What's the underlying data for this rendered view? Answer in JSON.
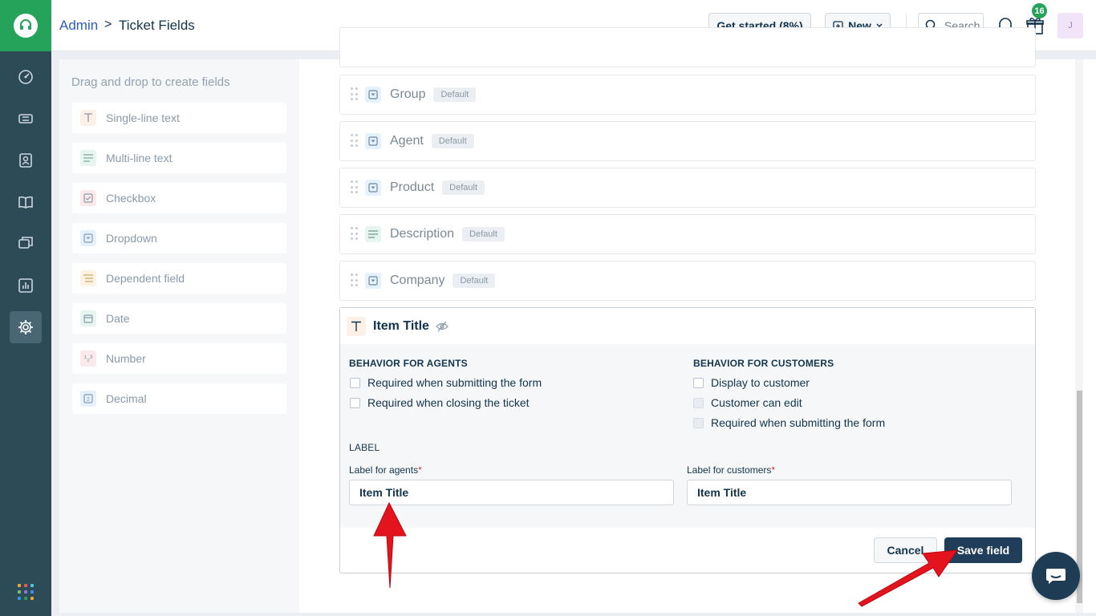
{
  "header": {
    "breadcrumb_root": "Admin",
    "breadcrumb_sep": ">",
    "page_title": "Ticket Fields",
    "get_started_label": "Get started (8%)",
    "new_label": "New",
    "search_placeholder": "Search",
    "notification_count": "16",
    "avatar_initial": "J"
  },
  "left_panel": {
    "title": "Drag and drop to create fields",
    "items": [
      {
        "label": "Single-line text",
        "icon": "single-line-text-icon"
      },
      {
        "label": "Multi-line text",
        "icon": "multi-line-text-icon"
      },
      {
        "label": "Checkbox",
        "icon": "checkbox-icon"
      },
      {
        "label": "Dropdown",
        "icon": "dropdown-icon"
      },
      {
        "label": "Dependent field",
        "icon": "dependent-field-icon"
      },
      {
        "label": "Date",
        "icon": "calendar-icon"
      },
      {
        "label": "Number",
        "icon": "number-icon"
      },
      {
        "label": "Decimal",
        "icon": "decimal-icon"
      }
    ]
  },
  "fields": [
    {
      "label": "Group",
      "badge": "Default",
      "icon": "dropdown-icon"
    },
    {
      "label": "Agent",
      "badge": "Default",
      "icon": "dropdown-icon"
    },
    {
      "label": "Product",
      "badge": "Default",
      "icon": "dropdown-icon"
    },
    {
      "label": "Description",
      "badge": "Default",
      "icon": "multi-line-text-icon"
    },
    {
      "label": "Company",
      "badge": "Default",
      "icon": "dropdown-icon"
    }
  ],
  "editor": {
    "title": "Item Title",
    "agents_section": "BEHAVIOR FOR AGENTS",
    "customers_section": "BEHAVIOR FOR CUSTOMERS",
    "agent_options": [
      "Required when submitting the form",
      "Required when closing the ticket"
    ],
    "customer_options": [
      "Display to customer",
      "Customer can edit",
      "Required when submitting the form"
    ],
    "label_section": "LABEL",
    "label_agents": "Label for agents",
    "label_customers": "Label for customers",
    "required_mark": "*",
    "agent_label_value": "Item Title",
    "customer_label_value": "Item Title",
    "cancel_label": "Cancel",
    "save_label": "Save field"
  },
  "colors": {
    "brand_green": "#25a35a",
    "nav_bg": "#2c4b57",
    "primary_button": "#203e5a",
    "annotation_arrow": "#e3141d"
  }
}
